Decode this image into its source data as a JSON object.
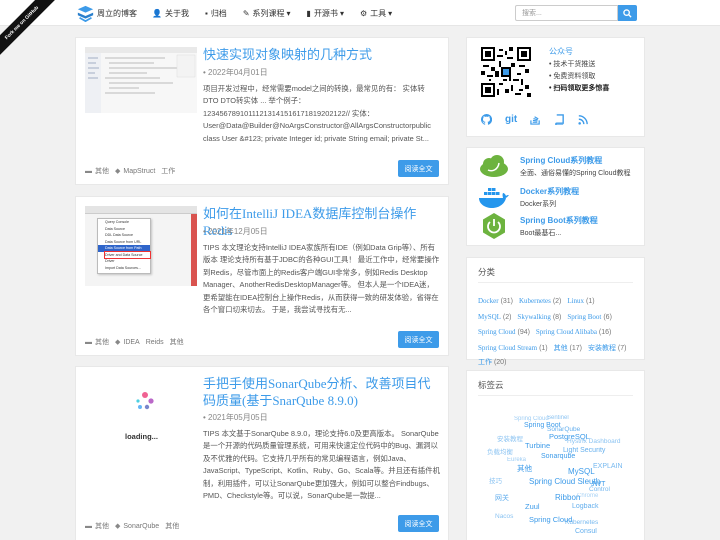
{
  "ribbon": "Fork me on GitHub",
  "nav": {
    "brand": "周立的博客",
    "menu": [
      {
        "icon": "user-icon",
        "glyph": "👤",
        "label": "关于我"
      },
      {
        "icon": "archive-icon",
        "glyph": "▪",
        "label": "归档"
      },
      {
        "icon": "pencil-icon",
        "glyph": "✎",
        "label": "系列课程"
      },
      {
        "icon": "book-icon",
        "glyph": "▮",
        "label": "开源书"
      },
      {
        "icon": "gear-icon",
        "glyph": "⚙",
        "label": "工具"
      }
    ],
    "dropdown_caret": "▾",
    "search_placeholder": "搜索...",
    "accent": "#3d9be9"
  },
  "posts": [
    {
      "title": "快速实现对象映射的几种方式",
      "date": "• 2022年04月01日",
      "excerpt": "项目开发过程中，经常需要model之间的转换，最常见的有： 实体转DTO DTO转实体 ... 举个例子：1234567891011121314151617181920212​2// 实体：User@Data@Builder@NoArgsConstructor@AllArgsConstructorpublic class User &#123; private Integer id; private String email; private St...",
      "tags": [
        "其他",
        "MapStruct",
        "工作"
      ],
      "read_more": "阅读全文"
    },
    {
      "title": "如何在IntelliJ IDEA数据库控制台操作Redis",
      "date": "• 2021年12月05日",
      "excerpt": "TIPS 本文理论支持IntelliJ IDEA家族所有IDE（例如Data Grip等）、所有版本 理论支持所有基于JDBC的各种GUI工具！ 最近工作中，经常要操作到Redis，尽管市面上的Redis客户端GUI非常多，例如Redis Desktop Manager、AnotherRedisDesktopManager等。 但本人是一个IDEA迷，更希望能在IDEA控制台上操作Redis，从而获得一致的研发体验，省得在各个窗口切来切去。 于是，我尝试寻找有无...",
      "tags": [
        "其他",
        "IDEA",
        "Reids",
        "其他"
      ],
      "read_more": "阅读全文",
      "menu_items": [
        "Query Console",
        "Data Source",
        "DDL Data Source",
        "Data Source from URL",
        "Data Source from Path",
        "Driver and Data Source",
        "Driver",
        "Import Data Sources..."
      ]
    },
    {
      "title": "手把手使用SonarQube分析、改善项目代码质量(基于SnarQube 8.9.0)",
      "date": "• 2021年05月05日",
      "loading": "loading...",
      "excerpt": "TIPS 本文基于SonarQube 8.9.0，理论支持6.0及更高版本。 SonarQube是一个开源的代码质量管理系统，可用来快速定位代码中的Bug、漏洞以及不优雅的代码。它支持几乎所有的常见编程语言，例如Java、JavaScript、TypeScript、Kotlin、Ruby、Go、Scala等。并且还有插件机制，利用插件，可以让SonarQube更加强大，例如可以整合Findbugs、PMD、Checkstyle等。可以说，SonarQube是一款提...",
      "tags": [
        "其他",
        "SonarQube",
        "其他"
      ],
      "read_more": "阅读全文"
    }
  ],
  "sidebar": {
    "gzh": {
      "title": "公众号",
      "lines": [
        "• 技术干货推送",
        "• 免费资料领取",
        "• 扫码领取更多惊喜"
      ],
      "social": [
        "github-icon",
        "git-icon",
        "stackoverflow-icon",
        "book-icon",
        "rss-icon"
      ],
      "git_label": "git"
    },
    "features": [
      {
        "title": "Spring Cloud系列教程",
        "desc": "全面、通俗易懂的Spring Cloud教程",
        "icon": "spring-cloud-icon"
      },
      {
        "title": "Docker系列教程",
        "desc": "Docker系列",
        "icon": "docker-icon"
      },
      {
        "title": "Spring Boot系列教程",
        "desc": "Boot最基石...",
        "icon": "spring-boot-icon"
      }
    ],
    "categories_title": "分类",
    "categories": [
      {
        "name": "Docker",
        "count": "(31)"
      },
      {
        "name": "Kubernetes",
        "count": "(2)"
      },
      {
        "name": "Linux",
        "count": "(1)"
      },
      {
        "name": "MySQL",
        "count": "(2)"
      },
      {
        "name": "Skywalking",
        "count": "(8)"
      },
      {
        "name": "Spring Boot",
        "count": "(6)"
      },
      {
        "name": "Spring Cloud",
        "count": "(94)"
      },
      {
        "name": "Spring Cloud Alibaba",
        "count": "(16)"
      },
      {
        "name": "Spring Cloud Stream",
        "count": "(1)"
      },
      {
        "name": "其他",
        "count": "(17)"
      },
      {
        "name": "安装教程",
        "count": "(7)"
      },
      {
        "name": "工作",
        "count": "(20)"
      }
    ],
    "tagcloud_title": "标签云",
    "tagcloud": [
      "Spring Cloud",
      "Sentinel",
      "Spring Boot",
      "SonarQube",
      "PostgreSQL",
      "Turbine",
      "Hystrix Dashboard",
      "Light Security",
      "Sonarqube",
      "MySQL",
      "EXPLAIN",
      "其他",
      "Spring Cloud Sleuth",
      "JWT",
      "Ribbon",
      "Zuul",
      "Logback",
      "Spring Cloud",
      "Kubernetes",
      "Consul",
      "Control",
      "安装教程",
      "负载均衡",
      "技巧",
      "网关",
      "Chrome",
      "Eureka",
      "Nacos"
    ]
  }
}
